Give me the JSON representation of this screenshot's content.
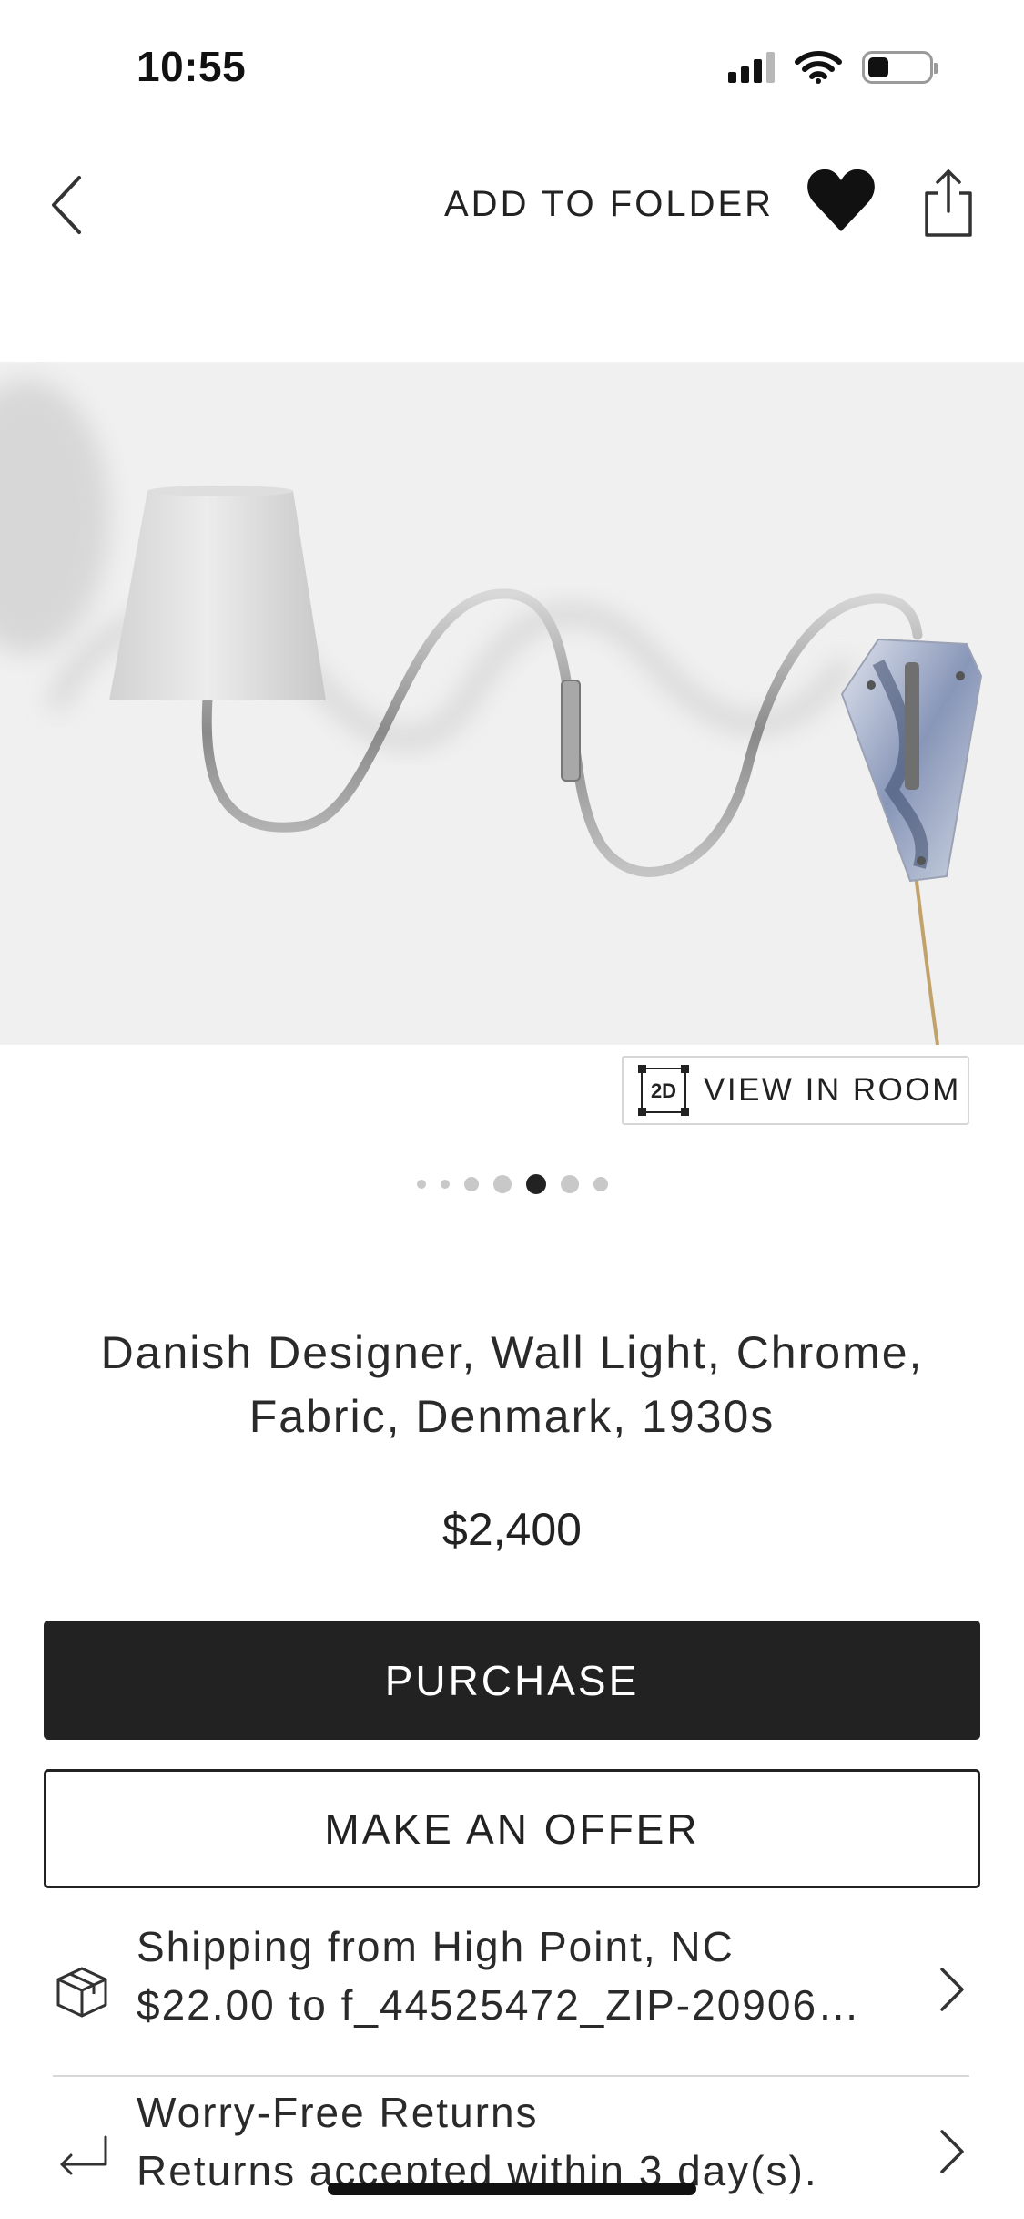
{
  "status_bar": {
    "time": "10:55",
    "battery_level": 0.35
  },
  "header": {
    "add_to_folder": "ADD TO FOLDER",
    "favorited": true
  },
  "gallery": {
    "view_in_room": "VIEW IN ROOM",
    "view_mode_badge": "2D",
    "total_images": 7,
    "active_index": 4
  },
  "product": {
    "title": "Danish Designer, Wall Light, Chrome, Fabric, Denmark, 1930s",
    "price": "$2,400"
  },
  "actions": {
    "purchase": "PURCHASE",
    "offer": "MAKE AN OFFER"
  },
  "shipping": {
    "title": "Shipping from High Point, NC",
    "detail": "$22.00 to f_44525472_ZIP-20906…"
  },
  "returns": {
    "title": "Worry-Free Returns",
    "detail": "Returns accepted within 3 day(s)."
  },
  "colors": {
    "primary": "#222222",
    "image_background": "#f0f0f0",
    "divider": "#d8d8d8"
  },
  "icons": [
    "signal-icon",
    "wifi-icon",
    "battery-icon",
    "back-icon",
    "heart-icon",
    "share-icon",
    "view-in-room-icon",
    "package-icon",
    "return-icon",
    "chevron-right-icon"
  ]
}
